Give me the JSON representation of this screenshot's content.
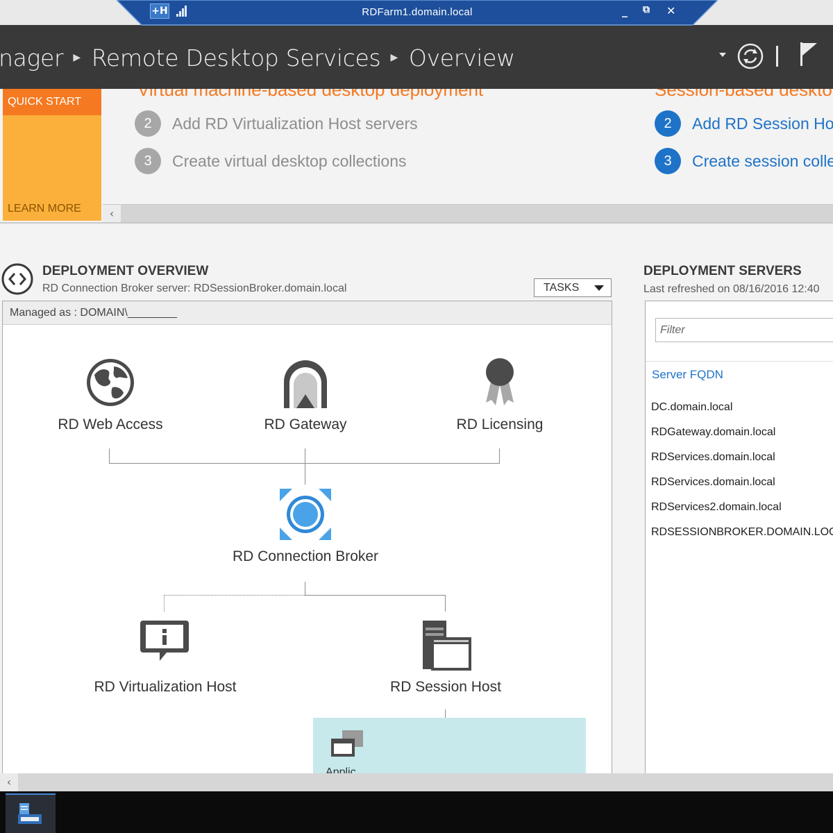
{
  "rdp_bar": {
    "title": "RDFarm1.domain.local",
    "pin_label": "+H",
    "minimize": "_",
    "restore": "⧉",
    "close": "✕"
  },
  "header": {
    "breadcrumb": [
      "nager",
      "Remote Desktop Services",
      "Overview"
    ],
    "icons": [
      "dropdown-arrow-icon",
      "refresh-icon",
      "flag-icon"
    ]
  },
  "quick_start": {
    "tile_top": "QUICK START",
    "tile_bottom": "LEARN MORE",
    "vdi": {
      "heading": "Virtual machine-based desktop deployment",
      "steps": [
        {
          "num": "2",
          "label": "Add RD Virtualization Host servers"
        },
        {
          "num": "3",
          "label": "Create virtual desktop collections"
        }
      ]
    },
    "session": {
      "heading": "Session-based desktop deployment",
      "steps": [
        {
          "num": "2",
          "label": "Add RD Session Host servers"
        },
        {
          "num": "3",
          "label": "Create session collections"
        }
      ]
    },
    "scroll_left": "‹"
  },
  "deployment_overview": {
    "title": "DEPLOYMENT OVERVIEW",
    "subtitle": "RD Connection Broker server: RDSessionBroker.domain.local",
    "tasks_label": "TASKS",
    "managed_as": "Managed as : DOMAIN\\________",
    "roles": {
      "web_access": "RD Web Access",
      "gateway": "RD Gateway",
      "licensing": "RD Licensing",
      "broker": "RD Connection Broker",
      "virtualization_host": "RD Virtualization Host",
      "session_host": "RD Session Host"
    },
    "collection_label": "Applic..."
  },
  "deployment_servers": {
    "title": "DEPLOYMENT SERVERS",
    "subtitle": "Last refreshed on 08/16/2016 12:40",
    "filter_placeholder": "Filter",
    "column_header": "Server FQDN",
    "servers": [
      "DC.domain.local",
      "RDGateway.domain.local",
      "RDServices.domain.local",
      "RDServices.domain.local",
      "RDServices2.domain.local",
      "RDSESSIONBROKER.DOMAIN.LOCAL"
    ]
  },
  "bottom_scroll": {
    "left": "‹"
  },
  "taskbar": {
    "apps": [
      "server-manager-icon"
    ]
  },
  "colors": {
    "header_bg": "#393939",
    "quick_start_orange": "#f47920",
    "quick_start_tile": "#fbb03b",
    "link_blue": "#1e73c8",
    "collection_bg": "#c7e9ec"
  }
}
